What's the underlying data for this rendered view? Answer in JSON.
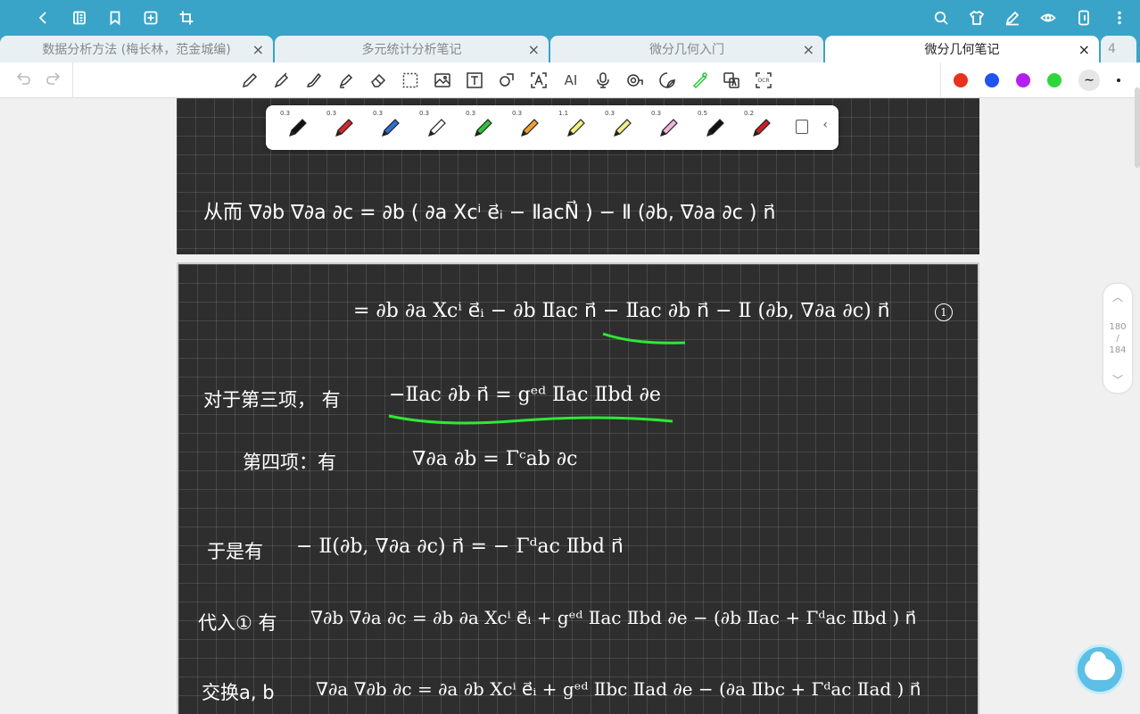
{
  "topbar": {
    "left_icons": [
      "back-icon",
      "sidebar-icon",
      "bookmark-icon",
      "add-page-icon",
      "crop-icon"
    ],
    "right_icons": [
      "search-icon",
      "shirt-icon",
      "pen-edit-icon",
      "eye-icon",
      "tablet-icon",
      "more-icon"
    ]
  },
  "tabs": [
    {
      "label": "数据分析方法 (梅长林，范金城编)",
      "active": false
    },
    {
      "label": "多元统计分析笔记",
      "active": false
    },
    {
      "label": "微分几何入门",
      "active": false
    },
    {
      "label": "微分几何笔记",
      "active": true
    }
  ],
  "tab_overflow": "4",
  "tab_close": "×",
  "toolbar": {
    "tools": [
      "pencil-icon",
      "fountain-pen-icon",
      "brush-icon",
      "highlighter-icon",
      "eraser-icon",
      "lasso-icon",
      "image-icon",
      "text-icon",
      "shape-icon",
      "ocr-text-icon",
      "ai-icon",
      "mic-icon",
      "tape-icon",
      "sticker-icon",
      "laser-icon",
      "translate-icon",
      "ocr-icon"
    ],
    "ai_label": "AI",
    "ocr_label": "OCR",
    "colors": [
      "#e8321e",
      "#2053f0",
      "#b21ff0",
      "#2fd63a"
    ]
  },
  "pens": [
    {
      "width": "0.3",
      "color": "#111111"
    },
    {
      "width": "0.3",
      "color": "#d6262e"
    },
    {
      "width": "0.3",
      "color": "#2a6fd6"
    },
    {
      "width": "0.3",
      "color": "#ffffff"
    },
    {
      "width": "0.3",
      "color": "#2ec43a"
    },
    {
      "width": "0.3",
      "color": "#f0a030"
    },
    {
      "width": "1.1",
      "color": "#f4f080"
    },
    {
      "width": "0.3",
      "color": "#f2ee8a"
    },
    {
      "width": "0.3",
      "color": "#f2b4d8"
    },
    {
      "width": "0.5",
      "color": "#111111"
    },
    {
      "width": "0.2",
      "color": "#c81e2a"
    }
  ],
  "page_indicator": {
    "current": "180",
    "sep": "/",
    "total": "184"
  },
  "notes": {
    "line1": "从而 ∇∂b ∇∂a ∂c =  ∂b ( ∂a Xcⁱ e⃗ᵢ − ⅡacN⃗ )  −  Ⅱ (∂b, ∇∂a ∂c ) n⃗",
    "line2": "= ∂b ∂a Xcⁱ e⃗ᵢ − ∂b Ⅱac n⃗ −  Ⅱac ∂b n⃗ −  Ⅱ (∂b, ∇∂a ∂c) n⃗",
    "circle_num": "1",
    "line3_label": "对于第三项，  有",
    "line3_eq": "−Ⅱac ∂b n⃗  =  gᵉᵈ Ⅱac Ⅱbd ∂e",
    "line4_label": "第四项：有",
    "line4_eq": "∇∂a ∂b = Γᶜab ∂c",
    "line5_label": "于是有",
    "line5_eq": "− Ⅱ(∂b, ∇∂a ∂c) n⃗  =  − Γᵈac Ⅱbd n⃗",
    "line6_label": "代入① 有",
    "line6_eq": "∇∂b ∇∂a ∂c =  ∂b ∂a Xcⁱ e⃗ᵢ  +  gᵉᵈ Ⅱac Ⅱbd ∂e − (∂b Ⅱac + Γᵈac Ⅱbd ) n⃗",
    "line7_label": "交换a, b",
    "line7_eq": "∇∂a ∇∂b ∂c =  ∂a ∂b Xcⁱ e⃗ᵢ  +  gᵉᵈ Ⅱbc Ⅱad ∂e  − (∂a Ⅱbc + Γᵈac Ⅱad ) n⃗"
  }
}
